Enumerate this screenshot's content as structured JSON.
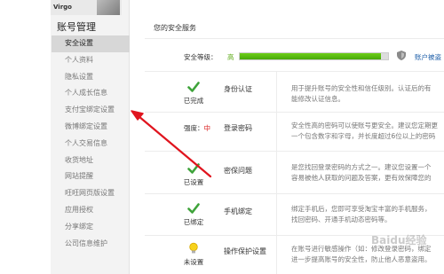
{
  "user": {
    "name": "Virgo"
  },
  "sidebar": {
    "title": "账号管理",
    "items": [
      {
        "label": "安全设置",
        "active": true
      },
      {
        "label": "个人资料"
      },
      {
        "label": "隐私设置"
      },
      {
        "label": "个人成长信息"
      },
      {
        "label": "支付宝绑定设置"
      },
      {
        "label": "微博绑定设置"
      },
      {
        "label": "个人交易信息"
      },
      {
        "label": "收货地址"
      },
      {
        "label": "网站提醒"
      },
      {
        "label": "旺旺网页版设置"
      },
      {
        "label": "应用授权"
      },
      {
        "label": "分享绑定"
      },
      {
        "label": "公司信息维护"
      }
    ]
  },
  "main": {
    "section_title": "您的安全服务",
    "security_level": {
      "label": "安全等级：",
      "value": "高",
      "progress": 0.95,
      "link": "账户被盗"
    },
    "items": [
      {
        "status": "已完成",
        "name": "身份认证",
        "desc_line1": "用于提升账号的安全性和信任级别。认证后的有",
        "desc_line2": "能修改认证信息。"
      },
      {
        "strength_label": "强度：",
        "strength_value": "中",
        "name": "登录密码",
        "desc_line1": "安全性高的密码可以使账号更安全。建议您定期更",
        "desc_line2": "一个包含数字和字母，并长度超过6位以上的密码"
      },
      {
        "status": "已设置",
        "name": "密保问题",
        "desc_line1": "是您找回登录密码的方式之一。建议您设置一个",
        "desc_line2": "容易被他人获取的问题及答案，更有效保障您的"
      },
      {
        "status": "已绑定",
        "name": "手机绑定",
        "desc_line1": "绑定手机后，您即可享受淘宝丰富的手机服务，",
        "desc_line2": "找回密码、开通手机动态密码等。"
      },
      {
        "status": "未设置",
        "name": "操作保护设置",
        "desc_line1": "在账号进行敏感操作（如：修改登录密码，绑定",
        "desc_line2": "进一步提高账号的安全性，防止他人恶意盗用。"
      }
    ]
  },
  "watermark": "Baidu经验",
  "colors": {
    "accent_green": "#48a80a",
    "link_blue": "#1d5ea8",
    "arrow_red": "#e0141e",
    "sidebar_active": "#d7d7d7"
  }
}
